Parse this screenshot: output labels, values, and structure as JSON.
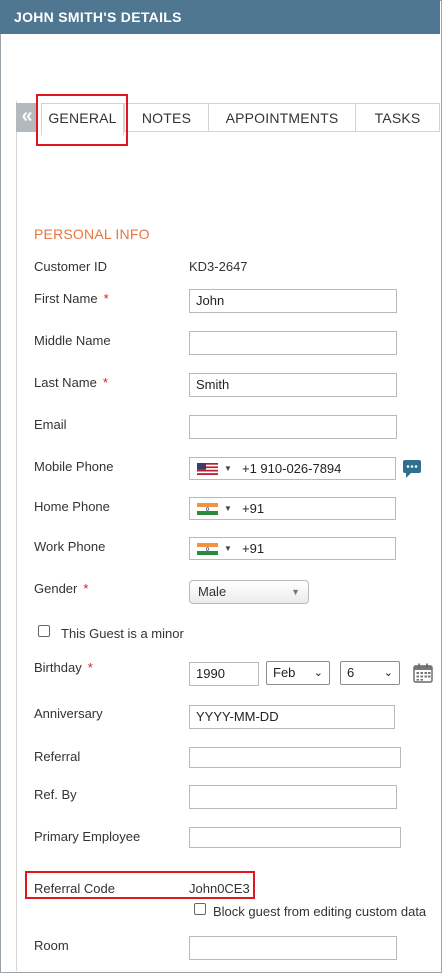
{
  "window": {
    "title": "JOHN SMITH'S DETAILS"
  },
  "tabs": [
    {
      "label": "GENERAL",
      "active": true
    },
    {
      "label": "NOTES",
      "active": false
    },
    {
      "label": "APPOINTMENTS",
      "active": false
    },
    {
      "label": "TASKS",
      "active": false
    }
  ],
  "collapse_glyph": "«",
  "section": {
    "title": "PERSONAL INFO"
  },
  "fields": {
    "customer_id": {
      "label": "Customer ID",
      "value": "KD3-2647"
    },
    "first_name": {
      "label": "First Name",
      "required": "*",
      "value": "John"
    },
    "middle_name": {
      "label": "Middle Name",
      "value": ""
    },
    "last_name": {
      "label": "Last Name",
      "required": "*",
      "value": "Smith"
    },
    "email": {
      "label": "Email",
      "value": ""
    },
    "mobile_phone": {
      "label": "Mobile Phone",
      "value": "+1 910-026-7894",
      "flag": "us-flag-icon"
    },
    "home_phone": {
      "label": "Home Phone",
      "value": "+91",
      "flag": "india-flag-icon"
    },
    "work_phone": {
      "label": "Work Phone",
      "value": "+91",
      "flag": "india-flag-icon"
    },
    "gender": {
      "label": "Gender",
      "required": "*",
      "value": "Male"
    },
    "minor": {
      "label": "This Guest is a minor",
      "checked": false
    },
    "birthday": {
      "label": "Birthday",
      "required": "*",
      "year": "1990",
      "month": "Feb",
      "day": "6"
    },
    "anniversary": {
      "label": "Anniversary",
      "placeholder": "YYYY-MM-DD"
    },
    "referral": {
      "label": "Referral",
      "value": ""
    },
    "ref_by": {
      "label": "Ref. By",
      "value": ""
    },
    "primary_employee": {
      "label": "Primary Employee",
      "value": ""
    },
    "referral_code": {
      "label": "Referral Code",
      "value": "John0CE3"
    },
    "block_guest": {
      "label": "Block guest from editing custom data",
      "checked": false
    },
    "room": {
      "label": "Room",
      "value": ""
    }
  },
  "colors": {
    "titlebar": "#4f7792",
    "section_title": "#e8763c",
    "required": "#d82020",
    "highlight": "#e2161f"
  }
}
